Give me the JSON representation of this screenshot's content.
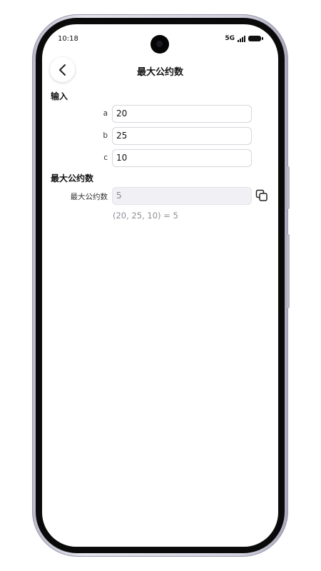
{
  "status_bar": {
    "time": "10:18",
    "network": "5G"
  },
  "header": {
    "title": "最大公约数",
    "back_icon": "chevron-left-icon"
  },
  "input_section": {
    "title": "输入",
    "fields": [
      {
        "label": "a",
        "value": "20"
      },
      {
        "label": "b",
        "value": "25"
      },
      {
        "label": "c",
        "value": "10"
      }
    ]
  },
  "result_section": {
    "title": "最大公约数",
    "label": "最大公约数",
    "value": "5",
    "copy_icon": "copy-icon",
    "expression": "(20, 25, 10) = 5"
  }
}
